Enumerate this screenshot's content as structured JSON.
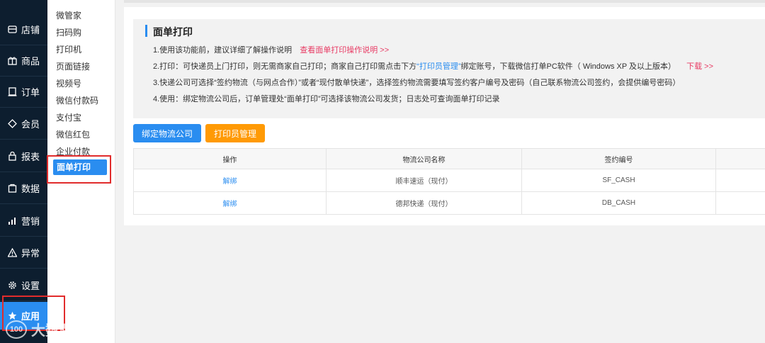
{
  "sidebar": {
    "items": [
      {
        "label": "店铺",
        "icon": "store-icon"
      },
      {
        "label": "商品",
        "icon": "gift-icon"
      },
      {
        "label": "订单",
        "icon": "order-icon"
      },
      {
        "label": "会员",
        "icon": "diamond-icon"
      },
      {
        "label": "报表",
        "icon": "lock-icon"
      },
      {
        "label": "数据",
        "icon": "data-icon"
      },
      {
        "label": "营销",
        "icon": "bar-chart-icon"
      },
      {
        "label": "异常",
        "icon": "warning-icon"
      },
      {
        "label": "设置",
        "icon": "gear-icon"
      },
      {
        "label": "应用",
        "icon": "star-icon"
      }
    ],
    "active": "应用"
  },
  "submenu": {
    "items": [
      "微管家",
      "扫码购",
      "打印机",
      "页面链接",
      "视频号",
      "微信付款码",
      "支付宝",
      "微信红包",
      "企业付款",
      "面单打印"
    ],
    "active": "面单打印"
  },
  "info": {
    "title": "面单打印",
    "line1": "1.使用该功能前，建议详细了解操作说明",
    "line1_link": "查看面单打印操作说明 >>",
    "line2_a": "2.打印：可快递员上门打印，则无需商家自己打印；商家自己打印需点击下方",
    "line2_link": "“打印员管理”",
    "line2_b": "绑定账号，下载微信打单PC软件（ Windows XP 及以上版本）",
    "line2_download": "下载 >>",
    "line3": "3.快递公司可选择“签约物流（与网点合作）”或者“现付散单快递”，选择签约物流需要填写签约客户编号及密码（自己联系物流公司签约，会提供编号密码）",
    "line4": "4.使用：绑定物流公司后，订单管理处“面单打印”可选择该物流公司发货；日志处可查询面单打印记录"
  },
  "buttons": {
    "bind": "绑定物流公司",
    "printer_manage": "打印员管理"
  },
  "table": {
    "headers": [
      "操作",
      "物流公司名称",
      "签约编号",
      ""
    ],
    "rows": [
      {
        "action": "解绑",
        "company": "顺丰速运（现付）",
        "code": "SF_CASH"
      },
      {
        "action": "解绑",
        "company": "德邦快递（现付）",
        "code": "DB_CASH"
      }
    ]
  },
  "watermark": {
    "logo": "100",
    "text": "大数跨境"
  },
  "colors": {
    "accent": "#2a8df0",
    "orange": "#ff9a05",
    "sidebar_bg": "#0d1e2f",
    "annotation": "#e12c2c",
    "link_red": "#e83b64"
  }
}
